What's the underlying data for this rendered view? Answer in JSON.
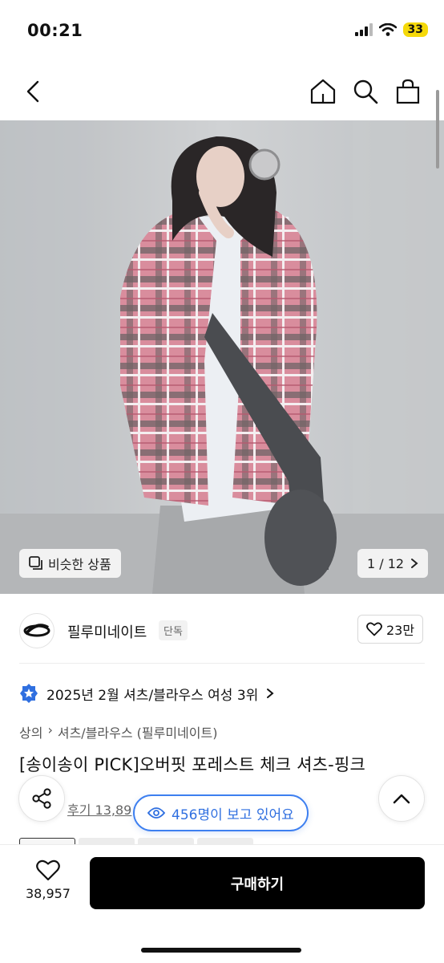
{
  "status": {
    "time": "00:21",
    "battery": "33"
  },
  "hero": {
    "similar_label": "비슷한 상품",
    "counter": "1 / 12"
  },
  "brand": {
    "name": "필루미네이트",
    "tag": "단독",
    "likes": "23만"
  },
  "rank": {
    "text": "2025년 2월 셔츠/블라우스 여성 3위"
  },
  "breadcrumb": {
    "level1": "상의",
    "level2": "셔츠/블라우스 (필루미네이트)"
  },
  "product": {
    "title": "[송이송이 PICK]오버핏 포레스트 체크 셔츠-핑크",
    "reviews": "후기 13,89"
  },
  "viewers": {
    "text": "456명이 보고 있어요"
  },
  "bottom": {
    "wish_count": "38,957",
    "buy_label": "구매하기"
  },
  "colors": {
    "accent_blue": "#2f6fe0",
    "buy_button": "#000000",
    "battery": "#f5d90a"
  },
  "icons": [
    "back-icon",
    "home-icon",
    "search-icon",
    "bag-icon",
    "heart-icon",
    "share-icon",
    "chevron-up-icon",
    "eye-icon",
    "star-badge-icon"
  ]
}
